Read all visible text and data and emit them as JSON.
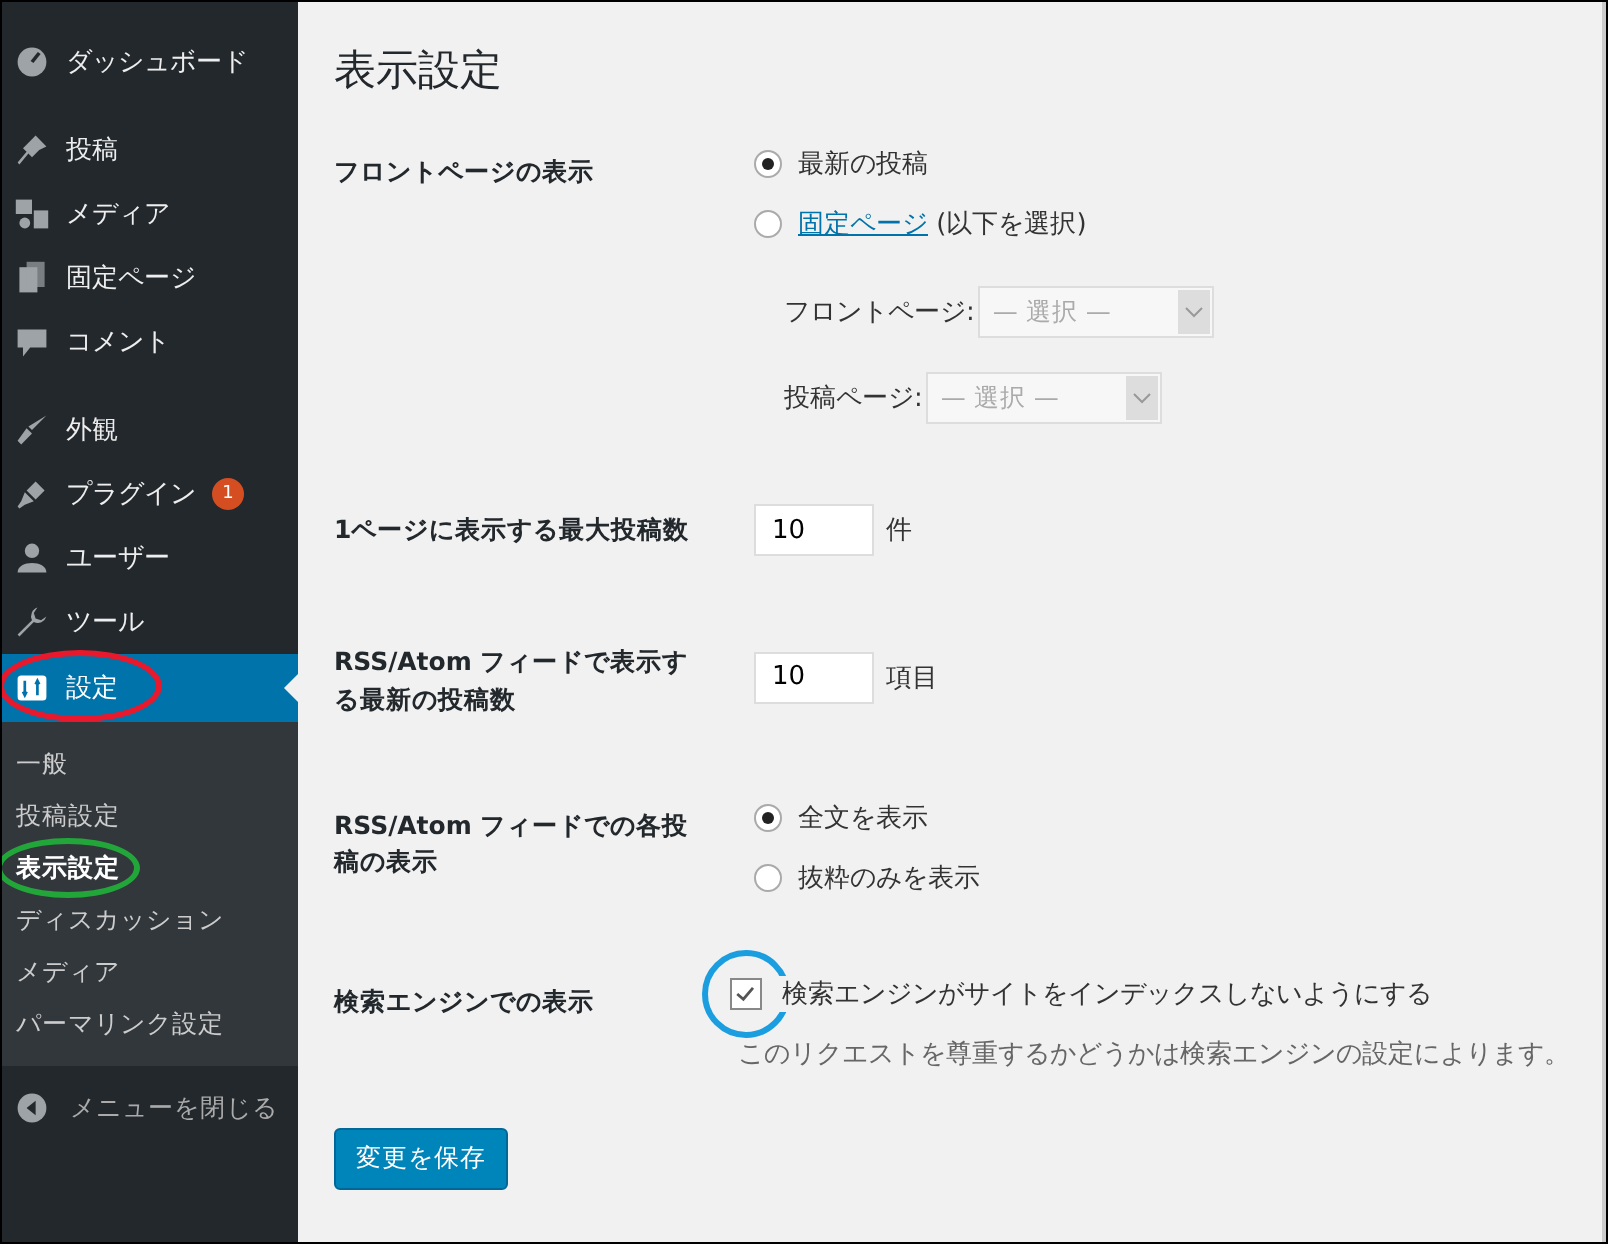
{
  "sidebar": {
    "groups": [
      {
        "items": [
          {
            "label": "ダッシュボード",
            "selected": false
          }
        ]
      },
      {
        "items": [
          {
            "label": "投稿",
            "selected": false
          },
          {
            "label": "メディア",
            "selected": false
          },
          {
            "label": "固定ページ",
            "selected": false
          },
          {
            "label": "コメント",
            "selected": false
          }
        ]
      },
      {
        "items": [
          {
            "label": "外観",
            "selected": false
          },
          {
            "label": "プラグイン",
            "selected": false,
            "badge": "1"
          },
          {
            "label": "ユーザー",
            "selected": false
          },
          {
            "label": "ツール",
            "selected": false
          },
          {
            "label": "設定",
            "selected": true,
            "ring": {
              "color": "#e8192c"
            }
          }
        ]
      }
    ],
    "submenu": [
      {
        "label": "一般",
        "selected": false
      },
      {
        "label": "投稿設定",
        "selected": false
      },
      {
        "label": "表示設定",
        "selected": true,
        "ring": {
          "color": "#22a63a"
        }
      },
      {
        "label": "ディスカッション",
        "selected": false
      },
      {
        "label": "メディア",
        "selected": false
      },
      {
        "label": "パーマリンク設定",
        "selected": false
      }
    ],
    "collapse": {
      "label": "メニューを閉じる"
    }
  },
  "main": {
    "title": "表示設定",
    "rows": [
      {
        "kind": "radio",
        "label": "フロントページの表示",
        "options": [
          {
            "label": "最新の投稿",
            "selected": true
          },
          {
            "link": "固定ページ",
            "label": "(以下を選択)",
            "selected": false
          }
        ],
        "selects": [
          {
            "label": "フロントページ:",
            "value": "— 選択 —",
            "disabled": true
          },
          {
            "label": "投稿ページ:",
            "value": "— 選択 —",
            "disabled": true
          }
        ]
      },
      {
        "kind": "number",
        "label": "1ページに表示する最大投稿数",
        "value": "10",
        "unit": "件"
      },
      {
        "kind": "number",
        "label": "RSS/Atom フィードで表示する最新の投稿数",
        "value": "10",
        "unit": "項目"
      },
      {
        "kind": "radio",
        "label": "RSS/Atom フィードでの各投稿の表示",
        "options": [
          {
            "label": "全文を表示",
            "selected": true
          },
          {
            "label": "抜粋のみを表示",
            "selected": false
          }
        ]
      },
      {
        "kind": "checkbox",
        "label": "検索エンジンでの表示",
        "text": "検索エンジンがサイトをインデックスしないようにする",
        "checked": true,
        "ring": {
          "color": "#1a9ee0"
        },
        "description": "このリクエストを尊重するかどうかは検索エンジンの設定によります。"
      }
    ],
    "save_button": "変更を保存"
  }
}
